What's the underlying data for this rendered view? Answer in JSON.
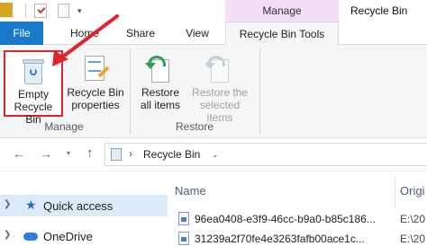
{
  "window": {
    "title": "Recycle Bin",
    "context_group": "Manage"
  },
  "tabs": [
    {
      "label": "File"
    },
    {
      "label": "Home"
    },
    {
      "label": "Share"
    },
    {
      "label": "View"
    },
    {
      "label": "Recycle Bin Tools"
    }
  ],
  "ribbon": {
    "manage": {
      "group_label": "Manage",
      "empty": {
        "line1": "Empty",
        "line2": "Recycle Bin"
      },
      "properties": {
        "line1": "Recycle Bin",
        "line2": "properties"
      }
    },
    "restore": {
      "group_label": "Restore",
      "restore_all": {
        "line1": "Restore",
        "line2": "all items"
      },
      "restore_selected": {
        "line1": "Restore the",
        "line2": "selected items"
      }
    }
  },
  "address": {
    "path": "Recycle Bin"
  },
  "nav_pane": {
    "items": [
      {
        "label": "Quick access"
      },
      {
        "label": "OneDrive"
      }
    ]
  },
  "file_list": {
    "columns": {
      "name": "Name",
      "original": "Origi"
    },
    "rows": [
      {
        "name": "96ea0408-e3f9-46cc-b9a0-b85c186...",
        "original": "E:\\20"
      },
      {
        "name": "31239a2f70fe4e3263fafb00ace1c...",
        "original": "E:\\20"
      }
    ]
  },
  "colors": {
    "file_tab": "#1979ca",
    "context_tab": "#f3dff5",
    "highlight_border": "#e0242d",
    "selection": "#dcebfa"
  }
}
